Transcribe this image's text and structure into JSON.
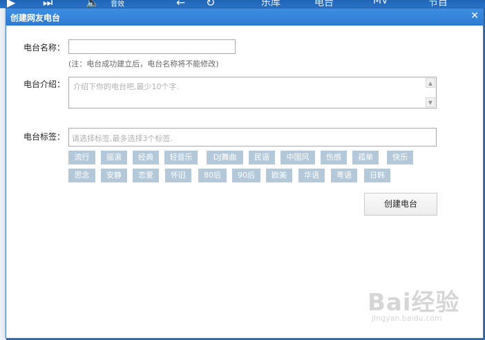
{
  "background": {
    "tabs": [
      "乐库",
      "电台",
      "MV",
      "节目"
    ],
    "volume_label": "音效"
  },
  "dialog": {
    "title": "创建网友电台",
    "name_label": "电台名称：",
    "name_value": "",
    "name_hint": "(注：电台成功建立后，电台名称将不能修改)",
    "intro_label": "电台介绍：",
    "intro_placeholder": "介绍下你的电台吧,最少10个字.",
    "tags_label": "电台标签：",
    "tags_placeholder": "请选择标签,最多选择3个标签.",
    "tags": [
      "流行",
      "摇滚",
      "经典",
      "轻音乐",
      "DJ舞曲",
      "民谣",
      "中国风",
      "伤感",
      "孤单",
      "快乐",
      "思念",
      "安静",
      "恋爱",
      "怀旧",
      "80后",
      "90后",
      "欧美",
      "华语",
      "粤语",
      "日韩"
    ],
    "create_button": "创建电台"
  },
  "watermark": {
    "logo": "Bai经验",
    "site": "jingyan.baidu.com"
  },
  "colors": {
    "titlebar": "#2d7ad2",
    "tag_bg": "#b3c8d9"
  }
}
